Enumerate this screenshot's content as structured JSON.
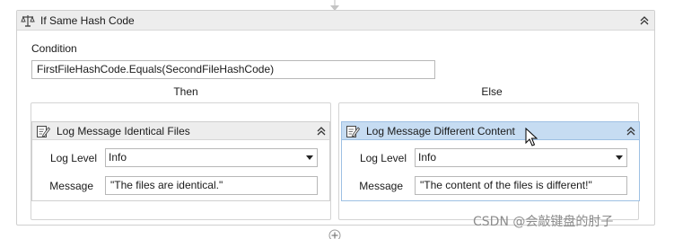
{
  "if_activity": {
    "title": "If Same Hash Code",
    "condition_label": "Condition",
    "condition_value": "FirstFileHashCode.Equals(SecondFileHashCode)",
    "then_label": "Then",
    "else_label": "Else"
  },
  "then_activity": {
    "title": "Log Message Identical Files",
    "log_level_label": "Log Level",
    "log_level_value": "Info",
    "message_label": "Message",
    "message_value": "\"The files are identical.\""
  },
  "else_activity": {
    "title": "Log Message Different Content",
    "log_level_label": "Log Level",
    "log_level_value": "Info",
    "message_label": "Message",
    "message_value": "\"The content of the files is different!\""
  },
  "watermark": "CSDN @会敲键盘的肘子",
  "colors": {
    "header_bg": "#ededed",
    "selected_header_bg": "#c6dcf2",
    "border": "#cfcfcf"
  }
}
